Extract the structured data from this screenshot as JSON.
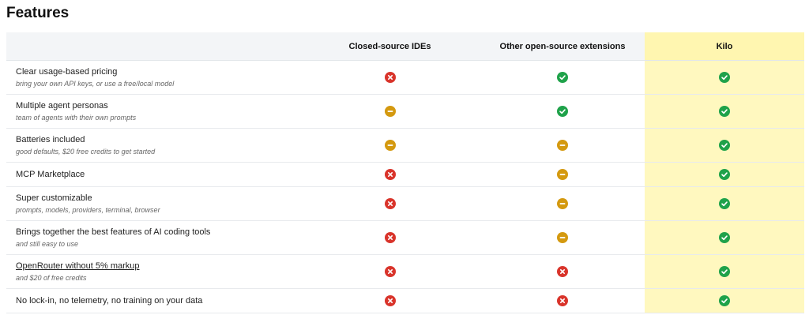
{
  "page": {
    "title": "Features"
  },
  "columns": {
    "feature": "",
    "closed": "Closed-source IDEs",
    "other": "Other open-source extensions",
    "kilo": "Kilo"
  },
  "colors": {
    "yes": "#1fa24a",
    "no": "#d9342b",
    "partial": "#d4990f",
    "kilo_highlight": "#fff8bf",
    "header_bg": "#f3f5f7"
  },
  "rows": [
    {
      "title": "Clear usage-based pricing",
      "subtitle": "bring your own API keys, or use a free/local model",
      "link": false,
      "closed": "no",
      "other": "yes",
      "kilo": "yes"
    },
    {
      "title": "Multiple agent personas",
      "subtitle": "team of agents with their own prompts",
      "link": false,
      "closed": "partial",
      "other": "yes",
      "kilo": "yes"
    },
    {
      "title": "Batteries included",
      "subtitle": "good defaults, $20 free credits to get started",
      "link": false,
      "closed": "partial",
      "other": "partial",
      "kilo": "yes"
    },
    {
      "title": "MCP Marketplace",
      "subtitle": "",
      "link": false,
      "closed": "no",
      "other": "partial",
      "kilo": "yes"
    },
    {
      "title": "Super customizable",
      "subtitle": "prompts, models, providers, terminal, browser",
      "link": false,
      "closed": "no",
      "other": "partial",
      "kilo": "yes"
    },
    {
      "title": "Brings together the best features of AI coding tools",
      "subtitle": "and still easy to use",
      "link": false,
      "closed": "no",
      "other": "partial",
      "kilo": "yes"
    },
    {
      "title": "OpenRouter without 5% markup",
      "subtitle": "and $20 of free credits",
      "link": true,
      "closed": "no",
      "other": "no",
      "kilo": "yes"
    },
    {
      "title": "No lock-in, no telemetry, no training on your data",
      "subtitle": "",
      "link": false,
      "closed": "no",
      "other": "no",
      "kilo": "yes"
    }
  ]
}
